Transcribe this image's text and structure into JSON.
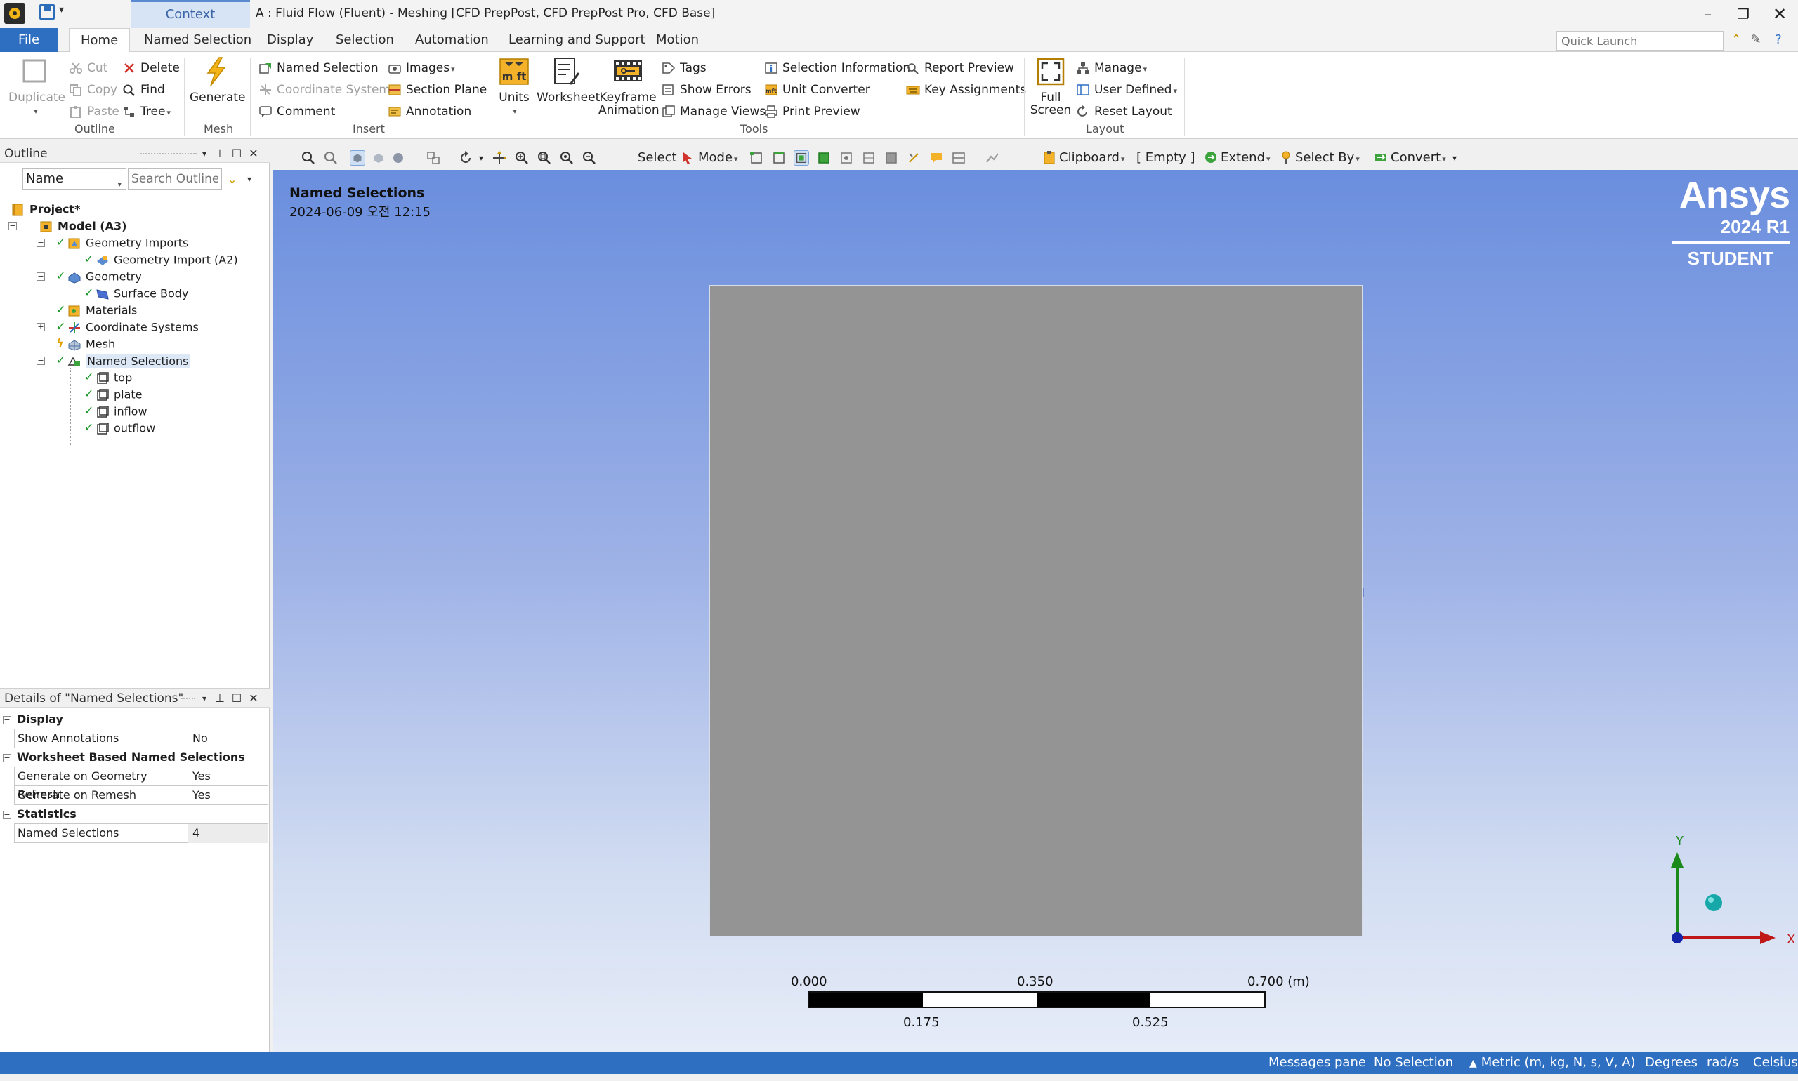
{
  "window": {
    "context_tab": "Context",
    "title": "A : Fluid Flow (Fluent) - Meshing [CFD PrepPost, CFD PrepPost Pro, CFD Base]",
    "min": "–",
    "restore": "❐",
    "close": "✕"
  },
  "ribbon_tabs": {
    "file": "File",
    "tabs": [
      "Home",
      "Named Selection",
      "Display",
      "Selection",
      "Automation",
      "Learning and Support",
      "Motion"
    ],
    "active": "Home",
    "quick_launch_placeholder": "Quick Launch"
  },
  "ribbon": {
    "outline": {
      "label": "Outline",
      "duplicate": "Duplicate",
      "cut": "Cut",
      "copy": "Copy",
      "paste": "Paste",
      "delete": "Delete",
      "find": "Find",
      "tree": "Tree"
    },
    "mesh": {
      "label": "Mesh",
      "generate": "Generate"
    },
    "insert": {
      "label": "Insert",
      "named_selection": "Named Selection",
      "coordinate_system": "Coordinate System",
      "comment": "Comment",
      "images": "Images",
      "section_plane": "Section Plane",
      "annotation": "Annotation"
    },
    "tools": {
      "label": "Tools",
      "units": "Units",
      "worksheet": "Worksheet",
      "keyframe_1": "Keyframe",
      "keyframe_2": "Animation",
      "tags": "Tags",
      "show_errors": "Show Errors",
      "manage_views": "Manage Views",
      "selection_information": "Selection Information",
      "unit_converter": "Unit Converter",
      "print_preview": "Print Preview",
      "report_preview": "Report Preview",
      "key_assignments": "Key Assignments"
    },
    "layout": {
      "label": "Layout",
      "full_1": "Full",
      "full_2": "Screen",
      "manage": "Manage",
      "user_defined": "User Defined",
      "reset_layout": "Reset Layout"
    }
  },
  "graphics_toolbar": {
    "select": "Select",
    "mode": "Mode",
    "clipboard": "Clipboard",
    "empty": "[ Empty ]",
    "extend": "Extend",
    "select_by": "Select By",
    "convert": "Convert"
  },
  "outline": {
    "title": "Outline",
    "name_filter": "Name",
    "search_placeholder": "Search Outline",
    "tree": [
      {
        "label": "Project*"
      },
      {
        "label": "Model (A3)"
      },
      {
        "label": "Geometry Imports"
      },
      {
        "label": "Geometry Import (A2)"
      },
      {
        "label": "Geometry"
      },
      {
        "label": "Surface Body"
      },
      {
        "label": "Materials"
      },
      {
        "label": "Coordinate Systems"
      },
      {
        "label": "Mesh"
      },
      {
        "label": "Named Selections"
      },
      {
        "label": "top"
      },
      {
        "label": "plate"
      },
      {
        "label": "inflow"
      },
      {
        "label": "outflow"
      }
    ]
  },
  "details": {
    "title": "Details of \"Named Selections\"",
    "sections": [
      {
        "name": "Display",
        "rows": [
          {
            "name": "Show Annotations",
            "value": "No"
          }
        ]
      },
      {
        "name": "Worksheet Based Named Selections",
        "rows": [
          {
            "name": "Generate on Geometry Refresh",
            "value": "Yes"
          },
          {
            "name": "Generate on Remesh",
            "value": "Yes"
          }
        ]
      },
      {
        "name": "Statistics",
        "rows": [
          {
            "name": "Named Selections",
            "value": "4"
          }
        ]
      }
    ]
  },
  "viewport": {
    "title": "Named Selections",
    "date": "2024-06-09 오전 12:15",
    "brand": {
      "name": "Ansys",
      "version": "2024 R1",
      "edition": "STUDENT"
    },
    "scale": {
      "top": [
        "0.000",
        "0.350",
        "0.700 (m)"
      ],
      "bottom": [
        "0.175",
        "0.525"
      ]
    },
    "axis": {
      "y": "Y",
      "x": "X"
    }
  },
  "statusbar": {
    "messages": "Messages pane",
    "selection": "No Selection",
    "units": "Metric (m, kg, N, s, V, A)",
    "angle": "Degrees",
    "rotation": "rad/s",
    "temperature": "Celsius"
  },
  "colors": {
    "accent": "#2e6fc2",
    "check_green": "#1c9c2a",
    "body_gray": "#949494",
    "viewport_top": "#6a8ede",
    "viewport_bottom": "#e6ecf8"
  }
}
